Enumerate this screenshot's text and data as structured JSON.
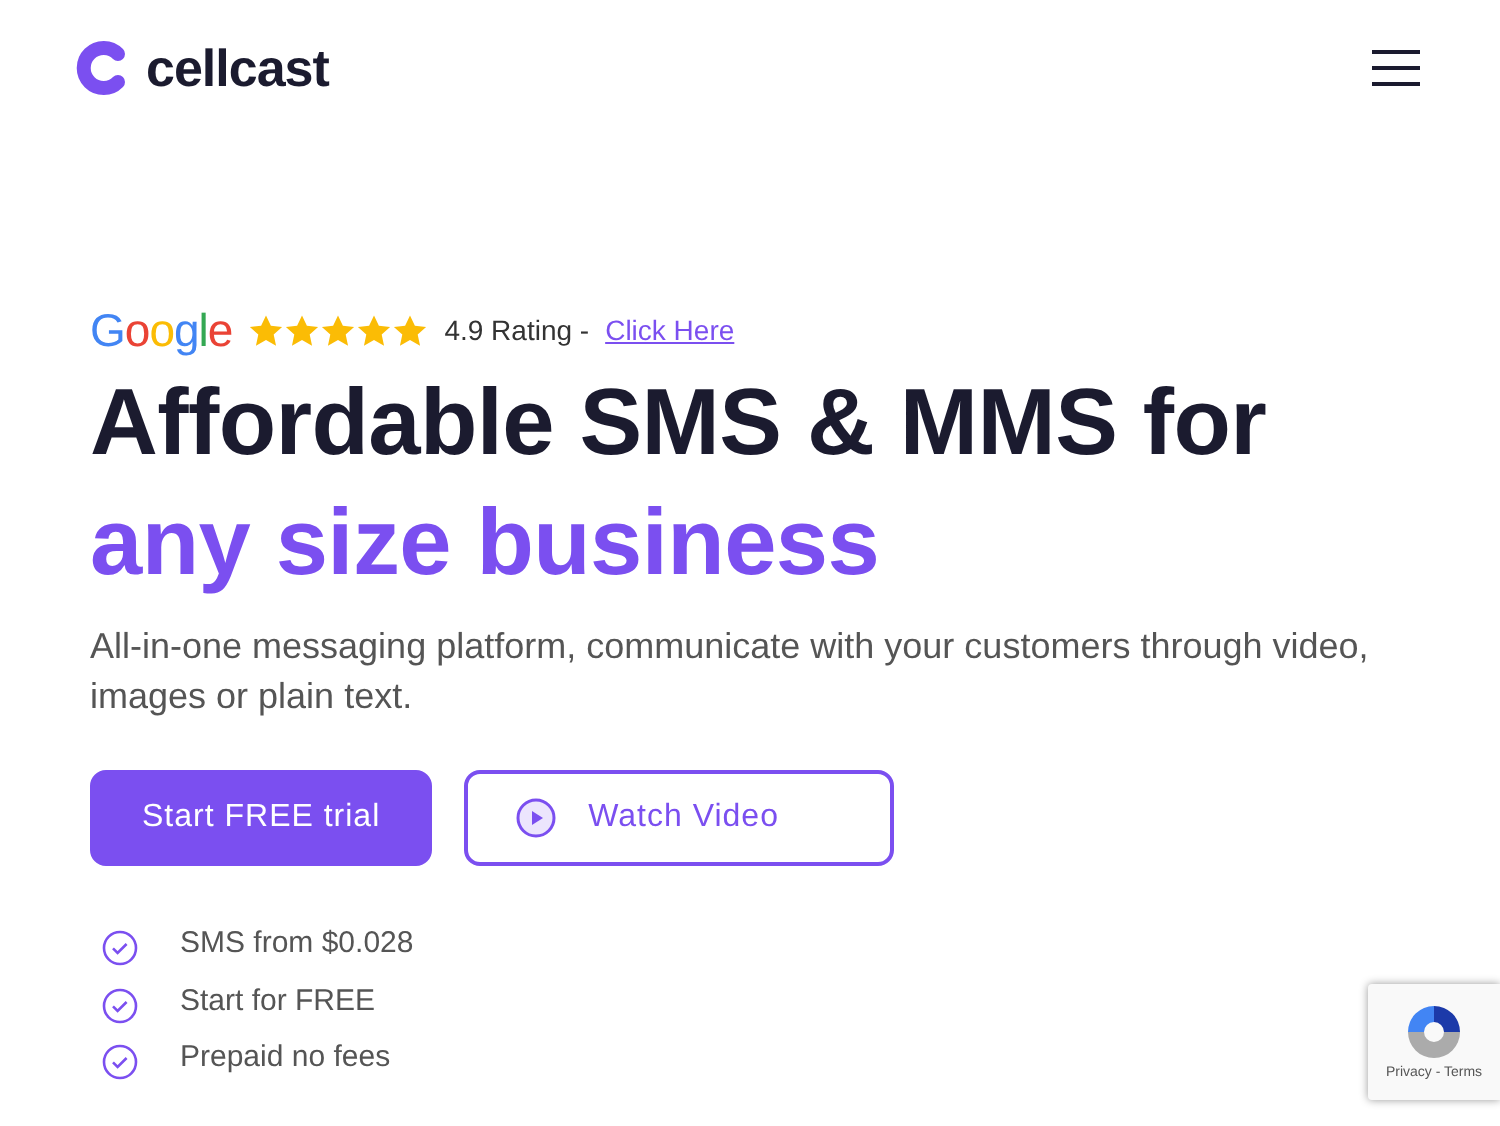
{
  "brand": {
    "name": "cellcast"
  },
  "rating": {
    "provider": "Google",
    "stars": 5,
    "text": "4.9 Rating -",
    "link": "Click Here"
  },
  "headline": [
    {
      "text": "Affordable SMS & MMS for",
      "kind": "dark"
    },
    {
      "text": "any size business",
      "kind": "accent"
    }
  ],
  "subtitle": "All-in-one messaging platform, communicate with your customers through video, images or plain text.",
  "buttons": [
    {
      "label": "Start FREE trial",
      "kind": "primary"
    },
    {
      "label": "Watch Video",
      "kind": "video"
    }
  ],
  "features": [
    "SMS from $0.028",
    "Start for FREE",
    "Prepaid no fees"
  ],
  "recaptcha": {
    "links": "Privacy - Terms"
  }
}
